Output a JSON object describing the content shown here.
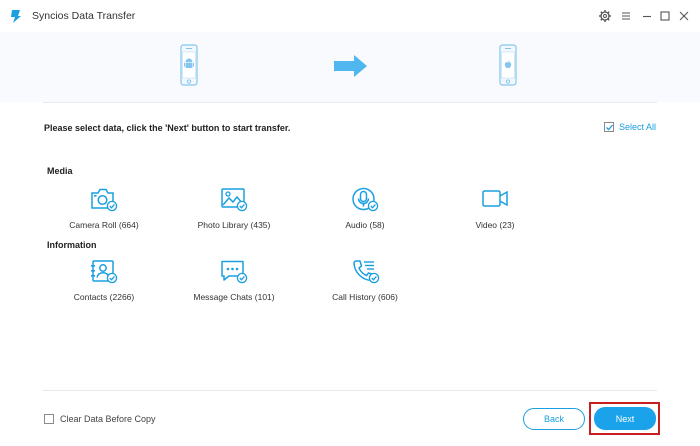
{
  "window": {
    "title": "Syncios Data Transfer",
    "controls": [
      "gear-icon",
      "menu-icon",
      "minimize-icon",
      "maximize-icon",
      "close-icon"
    ]
  },
  "transfer": {
    "source_device": "android",
    "target_device": "ios"
  },
  "instruction": "Please select data, click the 'Next' button to start transfer.",
  "select_all": {
    "label": "Select All",
    "checked": true
  },
  "sections": [
    {
      "title": "Media",
      "items": [
        {
          "label": "Camera Roll (664)",
          "icon": "camera-icon",
          "checked": true
        },
        {
          "label": "Photo Library (435)",
          "icon": "photo-icon",
          "checked": true
        },
        {
          "label": "Audio (58)",
          "icon": "microphone-icon",
          "checked": true
        },
        {
          "label": "Video (23)",
          "icon": "video-icon",
          "checked": true
        }
      ]
    },
    {
      "title": "Information",
      "items": [
        {
          "label": "Contacts (2266)",
          "icon": "contacts-icon",
          "checked": true
        },
        {
          "label": "Message Chats (101)",
          "icon": "message-icon",
          "checked": true
        },
        {
          "label": "Call History (606)",
          "icon": "call-history-icon",
          "checked": true
        }
      ]
    }
  ],
  "footer": {
    "clear_data_label": "Clear Data Before Copy",
    "clear_data_checked": false,
    "back_label": "Back",
    "next_label": "Next"
  },
  "colors": {
    "accent": "#1a9fe0",
    "highlight": "#c81e1e"
  }
}
